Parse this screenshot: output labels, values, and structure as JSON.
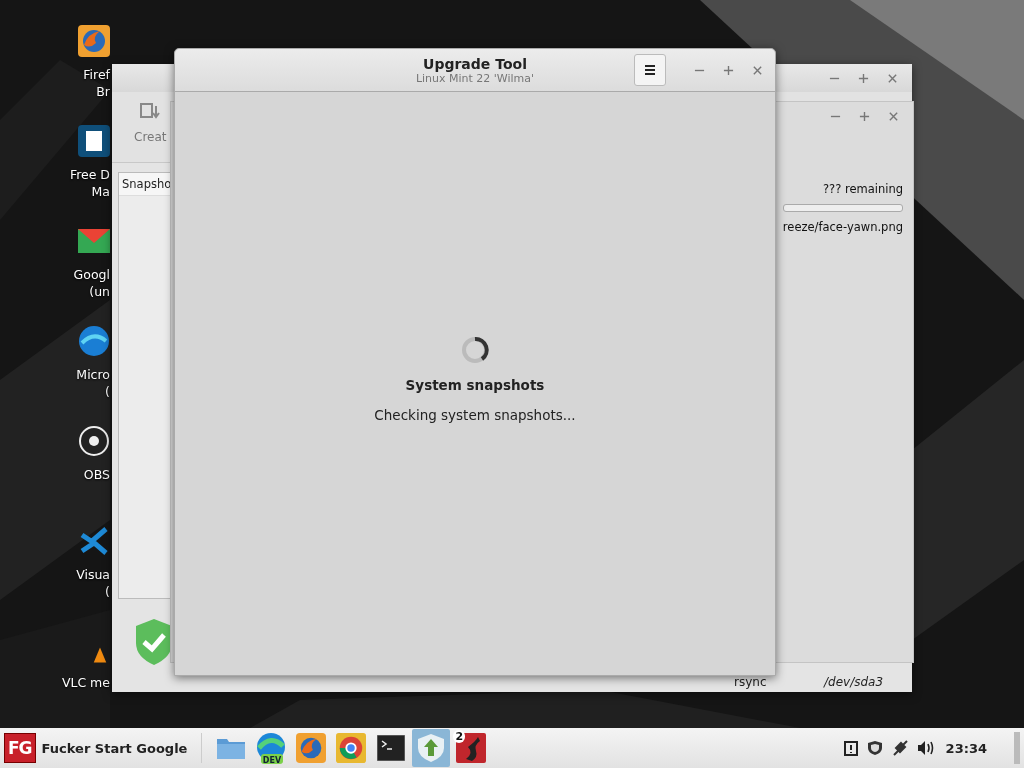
{
  "desktop_icons": [
    {
      "kind": "fox",
      "label_lines": [
        "Firef",
        "Br"
      ]
    },
    {
      "kind": "download",
      "label_lines": [
        "Free D",
        "Ma"
      ]
    },
    {
      "kind": "mail",
      "label_lines": [
        "Googl",
        "(un"
      ]
    },
    {
      "kind": "globe",
      "label_lines": [
        "Micro",
        "("
      ]
    },
    {
      "kind": "camera",
      "label_lines": [
        "OBS"
      ]
    },
    {
      "kind": "code",
      "label_lines": [
        "Visua",
        "("
      ]
    },
    {
      "kind": "cone",
      "label_lines": [
        "VLC me"
      ]
    }
  ],
  "backup_window": {
    "toolbar_button": "Creat",
    "list_header": "Snapsho",
    "footer_texts": [
      "rsync",
      "/dev/sda3"
    ]
  },
  "progress_window": {
    "remaining": "??? remaining",
    "level": 0,
    "file": "reeze/face-yawn.png"
  },
  "upgrade_window": {
    "title": "Upgrade Tool",
    "subtitle": "Linux Mint 22 'Wilma'",
    "heading": "System snapshots",
    "message": "Checking system snapshots..."
  },
  "taskbar": {
    "start_logo": "FG",
    "start_label": "Fucker Start Google",
    "tasks": [
      {
        "kind": "folder",
        "selected": false
      },
      {
        "kind": "edge",
        "badge": "DEV",
        "selected": false
      },
      {
        "kind": "fox",
        "selected": false
      },
      {
        "kind": "chrome",
        "selected": false
      },
      {
        "kind": "terminal",
        "selected": false
      },
      {
        "kind": "upgrade",
        "selected": true
      },
      {
        "kind": "red",
        "count": "2",
        "selected": false
      }
    ],
    "clock": "23:34"
  }
}
